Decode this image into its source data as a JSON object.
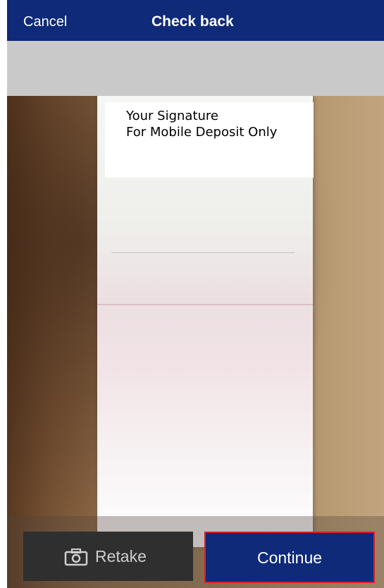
{
  "header": {
    "cancel_label": "Cancel",
    "title": "Check back"
  },
  "endorsement": {
    "line1": "Your Signature",
    "line2": "For Mobile Deposit Only"
  },
  "actions": {
    "retake_label": "Retake",
    "retake_icon": "camera-icon",
    "continue_label": "Continue"
  },
  "colors": {
    "nav_background": "#0e2a78",
    "continue_border": "#d81e2a",
    "retake_background": "#2f2f2f"
  }
}
